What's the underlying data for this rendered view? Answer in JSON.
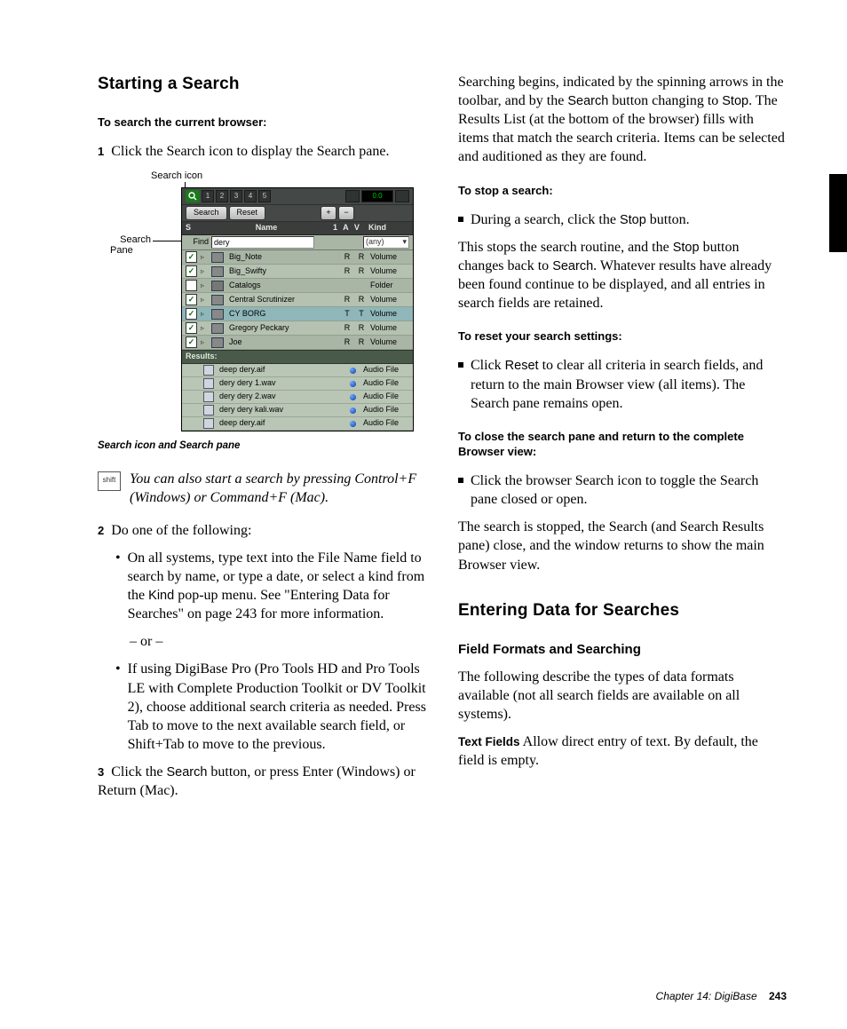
{
  "left": {
    "h_start": "Starting a Search",
    "lead1": "To search the current browser:",
    "step1_num": "1",
    "step1_text": " Click the Search icon to display the Search pane.",
    "fig": {
      "label_icon": "Search icon",
      "label_pane1": "Search",
      "label_pane2": "Pane",
      "toolbar_nums": [
        "1",
        "2",
        "3",
        "4",
        "5"
      ],
      "meter": "0.0",
      "btn_search": "Search",
      "btn_reset": "Reset",
      "hdr_s": "S",
      "hdr_name": "Name",
      "hdr_1av": "1  A  V",
      "hdr_kind": "Kind",
      "find_label": "Find",
      "find_value": "dery",
      "kind_any": "(any)",
      "rows": [
        {
          "ck": true,
          "name": "Big_Note",
          "f1": "R",
          "f2": "R",
          "kind": "Volume",
          "alt": false
        },
        {
          "ck": true,
          "name": "Big_Swifty",
          "f1": "R",
          "f2": "R",
          "kind": "Volume",
          "alt": true
        },
        {
          "ck": false,
          "name": "Catalogs",
          "f1": "",
          "f2": "",
          "kind": "Folder",
          "alt": false,
          "cat": true
        },
        {
          "ck": true,
          "name": "Central Scrutinizer",
          "f1": "R",
          "f2": "R",
          "kind": "Volume",
          "alt": true
        },
        {
          "ck": true,
          "name": "CY BORG",
          "f1": "T",
          "f2": "T",
          "kind": "Volume",
          "alt": false,
          "hl": true
        },
        {
          "ck": true,
          "name": "Gregory Peckary",
          "f1": "R",
          "f2": "R",
          "kind": "Volume",
          "alt": true
        },
        {
          "ck": true,
          "name": "Joe",
          "f1": "R",
          "f2": "R",
          "kind": "Volume",
          "alt": false
        }
      ],
      "results_label": "Results:",
      "results": [
        {
          "name": "deep dery.aif",
          "kind": "Audio File"
        },
        {
          "name": "dery dery 1.wav",
          "kind": "Audio File"
        },
        {
          "name": "dery dery 2.wav",
          "kind": "Audio File"
        },
        {
          "name": "dery dery kali.wav",
          "kind": "Audio File"
        },
        {
          "name": "deep dery.aif",
          "kind": "Audio File"
        }
      ]
    },
    "caption": "Search icon and Search pane",
    "tip_icon": "shift",
    "tip_text": "You can also start a search by pressing Control+F (Windows) or Command+F (Mac).",
    "step2_num": "2",
    "step2_text": " Do one of the following:",
    "b1a": "On all systems, type text into the File Name field to search by name, or type a date, or select a kind from the ",
    "b1_kind": "Kind",
    "b1b": " pop-up menu. See \"Entering Data for Searches\" on page 243 for more information.",
    "or": "– or –",
    "b2": "If using DigiBase Pro (Pro Tools HD and Pro Tools LE with Complete Production Toolkit or DV Toolkit 2), choose additional search criteria as needed. Press Tab to move to the next available search field, or Shift+Tab to move to the previous.",
    "step3_num": "3",
    "step3a": " Click the ",
    "step3_search": "Search",
    "step3b": " button, or press Enter (Windows) or Return (Mac)."
  },
  "right": {
    "p1a": "Searching begins, indicated by the spinning arrows in the toolbar, and by the ",
    "p1_search": "Search",
    "p1b": " button changing to ",
    "p1_stop": "Stop",
    "p1c": ". The Results List (at the bottom of the browser) fills with items that match the search criteria. Items can be selected and auditioned as they are found.",
    "lead_stop": "To stop a search:",
    "bl_stop_a": "During a search, click the ",
    "bl_stop_btn": "Stop",
    "bl_stop_b": " button.",
    "p2a": "This stops the search routine, and the ",
    "p2_stop": "Stop",
    "p2b": " button changes back to ",
    "p2_search": "Search",
    "p2c": ". Whatever results have already been found continue to be displayed, and all entries in search fields are retained.",
    "lead_reset": "To reset your search settings:",
    "bl_reset_a": "Click ",
    "bl_reset_btn": "Reset",
    "bl_reset_b": " to clear all criteria in search fields, and return to the main Browser view (all items). The Search pane remains open.",
    "lead_close": "To close the search pane and return to the complete Browser view:",
    "bl_close": "Click the browser Search icon to toggle the Search pane closed or open.",
    "p3": "The search is stopped, the Search (and Search Results pane) close, and the window returns to show the main Browser view.",
    "h_enter": "Entering Data for Searches",
    "h_field": "Field Formats and Searching",
    "p4": "The following describe the types of data formats available (not all search fields are available on all systems).",
    "runin": "Text Fields",
    "p5": " Allow direct entry of text. By default, the field is empty."
  },
  "footer": {
    "chapter": "Chapter 14: DigiBase",
    "page": "243"
  }
}
